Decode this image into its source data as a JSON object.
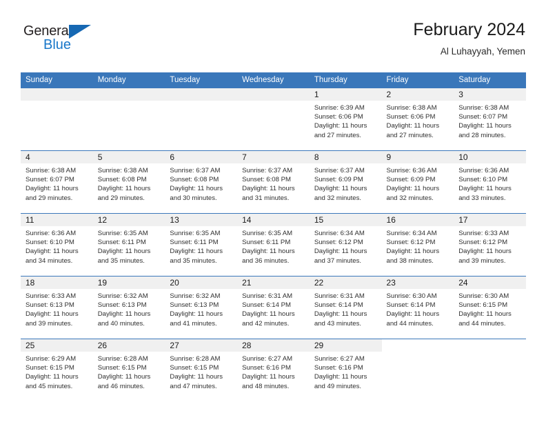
{
  "brand": {
    "name_top": "General",
    "name_bottom": "Blue",
    "triangle_icon": "brand-triangle-icon",
    "accent_color": "#1877c9"
  },
  "header": {
    "title": "February 2024",
    "subtitle": "Al Luhayyah, Yemen"
  },
  "theme": {
    "header_bg": "#3a77ba",
    "daynum_bg": "#f0f0f0",
    "grid_line": "#3a77ba",
    "text": "#2f2f2f"
  },
  "weekday_headers": [
    "Sunday",
    "Monday",
    "Tuesday",
    "Wednesday",
    "Thursday",
    "Friday",
    "Saturday"
  ],
  "calendar": {
    "month": "February",
    "year": "2024",
    "location": "Al Luhayyah, Yemen",
    "weeks": [
      [
        {
          "day": "",
          "sunrise": "",
          "sunset": "",
          "daylight1": "",
          "daylight2": "",
          "type": "empty"
        },
        {
          "day": "",
          "sunrise": "",
          "sunset": "",
          "daylight1": "",
          "daylight2": "",
          "type": "empty"
        },
        {
          "day": "",
          "sunrise": "",
          "sunset": "",
          "daylight1": "",
          "daylight2": "",
          "type": "empty"
        },
        {
          "day": "",
          "sunrise": "",
          "sunset": "",
          "daylight1": "",
          "daylight2": "",
          "type": "empty"
        },
        {
          "day": "1",
          "sunrise": "Sunrise: 6:39 AM",
          "sunset": "Sunset: 6:06 PM",
          "daylight1": "Daylight: 11 hours",
          "daylight2": "and 27 minutes.",
          "type": "day"
        },
        {
          "day": "2",
          "sunrise": "Sunrise: 6:38 AM",
          "sunset": "Sunset: 6:06 PM",
          "daylight1": "Daylight: 11 hours",
          "daylight2": "and 27 minutes.",
          "type": "day"
        },
        {
          "day": "3",
          "sunrise": "Sunrise: 6:38 AM",
          "sunset": "Sunset: 6:07 PM",
          "daylight1": "Daylight: 11 hours",
          "daylight2": "and 28 minutes.",
          "type": "day"
        }
      ],
      [
        {
          "day": "4",
          "sunrise": "Sunrise: 6:38 AM",
          "sunset": "Sunset: 6:07 PM",
          "daylight1": "Daylight: 11 hours",
          "daylight2": "and 29 minutes.",
          "type": "day"
        },
        {
          "day": "5",
          "sunrise": "Sunrise: 6:38 AM",
          "sunset": "Sunset: 6:08 PM",
          "daylight1": "Daylight: 11 hours",
          "daylight2": "and 29 minutes.",
          "type": "day"
        },
        {
          "day": "6",
          "sunrise": "Sunrise: 6:37 AM",
          "sunset": "Sunset: 6:08 PM",
          "daylight1": "Daylight: 11 hours",
          "daylight2": "and 30 minutes.",
          "type": "day"
        },
        {
          "day": "7",
          "sunrise": "Sunrise: 6:37 AM",
          "sunset": "Sunset: 6:08 PM",
          "daylight1": "Daylight: 11 hours",
          "daylight2": "and 31 minutes.",
          "type": "day"
        },
        {
          "day": "8",
          "sunrise": "Sunrise: 6:37 AM",
          "sunset": "Sunset: 6:09 PM",
          "daylight1": "Daylight: 11 hours",
          "daylight2": "and 32 minutes.",
          "type": "day"
        },
        {
          "day": "9",
          "sunrise": "Sunrise: 6:36 AM",
          "sunset": "Sunset: 6:09 PM",
          "daylight1": "Daylight: 11 hours",
          "daylight2": "and 32 minutes.",
          "type": "day"
        },
        {
          "day": "10",
          "sunrise": "Sunrise: 6:36 AM",
          "sunset": "Sunset: 6:10 PM",
          "daylight1": "Daylight: 11 hours",
          "daylight2": "and 33 minutes.",
          "type": "day"
        }
      ],
      [
        {
          "day": "11",
          "sunrise": "Sunrise: 6:36 AM",
          "sunset": "Sunset: 6:10 PM",
          "daylight1": "Daylight: 11 hours",
          "daylight2": "and 34 minutes.",
          "type": "day"
        },
        {
          "day": "12",
          "sunrise": "Sunrise: 6:35 AM",
          "sunset": "Sunset: 6:11 PM",
          "daylight1": "Daylight: 11 hours",
          "daylight2": "and 35 minutes.",
          "type": "day"
        },
        {
          "day": "13",
          "sunrise": "Sunrise: 6:35 AM",
          "sunset": "Sunset: 6:11 PM",
          "daylight1": "Daylight: 11 hours",
          "daylight2": "and 35 minutes.",
          "type": "day"
        },
        {
          "day": "14",
          "sunrise": "Sunrise: 6:35 AM",
          "sunset": "Sunset: 6:11 PM",
          "daylight1": "Daylight: 11 hours",
          "daylight2": "and 36 minutes.",
          "type": "day"
        },
        {
          "day": "15",
          "sunrise": "Sunrise: 6:34 AM",
          "sunset": "Sunset: 6:12 PM",
          "daylight1": "Daylight: 11 hours",
          "daylight2": "and 37 minutes.",
          "type": "day"
        },
        {
          "day": "16",
          "sunrise": "Sunrise: 6:34 AM",
          "sunset": "Sunset: 6:12 PM",
          "daylight1": "Daylight: 11 hours",
          "daylight2": "and 38 minutes.",
          "type": "day"
        },
        {
          "day": "17",
          "sunrise": "Sunrise: 6:33 AM",
          "sunset": "Sunset: 6:12 PM",
          "daylight1": "Daylight: 11 hours",
          "daylight2": "and 39 minutes.",
          "type": "day"
        }
      ],
      [
        {
          "day": "18",
          "sunrise": "Sunrise: 6:33 AM",
          "sunset": "Sunset: 6:13 PM",
          "daylight1": "Daylight: 11 hours",
          "daylight2": "and 39 minutes.",
          "type": "day"
        },
        {
          "day": "19",
          "sunrise": "Sunrise: 6:32 AM",
          "sunset": "Sunset: 6:13 PM",
          "daylight1": "Daylight: 11 hours",
          "daylight2": "and 40 minutes.",
          "type": "day"
        },
        {
          "day": "20",
          "sunrise": "Sunrise: 6:32 AM",
          "sunset": "Sunset: 6:13 PM",
          "daylight1": "Daylight: 11 hours",
          "daylight2": "and 41 minutes.",
          "type": "day"
        },
        {
          "day": "21",
          "sunrise": "Sunrise: 6:31 AM",
          "sunset": "Sunset: 6:14 PM",
          "daylight1": "Daylight: 11 hours",
          "daylight2": "and 42 minutes.",
          "type": "day"
        },
        {
          "day": "22",
          "sunrise": "Sunrise: 6:31 AM",
          "sunset": "Sunset: 6:14 PM",
          "daylight1": "Daylight: 11 hours",
          "daylight2": "and 43 minutes.",
          "type": "day"
        },
        {
          "day": "23",
          "sunrise": "Sunrise: 6:30 AM",
          "sunset": "Sunset: 6:14 PM",
          "daylight1": "Daylight: 11 hours",
          "daylight2": "and 44 minutes.",
          "type": "day"
        },
        {
          "day": "24",
          "sunrise": "Sunrise: 6:30 AM",
          "sunset": "Sunset: 6:15 PM",
          "daylight1": "Daylight: 11 hours",
          "daylight2": "and 44 minutes.",
          "type": "day"
        }
      ],
      [
        {
          "day": "25",
          "sunrise": "Sunrise: 6:29 AM",
          "sunset": "Sunset: 6:15 PM",
          "daylight1": "Daylight: 11 hours",
          "daylight2": "and 45 minutes.",
          "type": "day"
        },
        {
          "day": "26",
          "sunrise": "Sunrise: 6:28 AM",
          "sunset": "Sunset: 6:15 PM",
          "daylight1": "Daylight: 11 hours",
          "daylight2": "and 46 minutes.",
          "type": "day"
        },
        {
          "day": "27",
          "sunrise": "Sunrise: 6:28 AM",
          "sunset": "Sunset: 6:15 PM",
          "daylight1": "Daylight: 11 hours",
          "daylight2": "and 47 minutes.",
          "type": "day"
        },
        {
          "day": "28",
          "sunrise": "Sunrise: 6:27 AM",
          "sunset": "Sunset: 6:16 PM",
          "daylight1": "Daylight: 11 hours",
          "daylight2": "and 48 minutes.",
          "type": "day"
        },
        {
          "day": "29",
          "sunrise": "Sunrise: 6:27 AM",
          "sunset": "Sunset: 6:16 PM",
          "daylight1": "Daylight: 11 hours",
          "daylight2": "and 49 minutes.",
          "type": "day"
        },
        {
          "day": "",
          "sunrise": "",
          "sunset": "",
          "daylight1": "",
          "daylight2": "",
          "type": "blank"
        },
        {
          "day": "",
          "sunrise": "",
          "sunset": "",
          "daylight1": "",
          "daylight2": "",
          "type": "blank"
        }
      ]
    ]
  }
}
